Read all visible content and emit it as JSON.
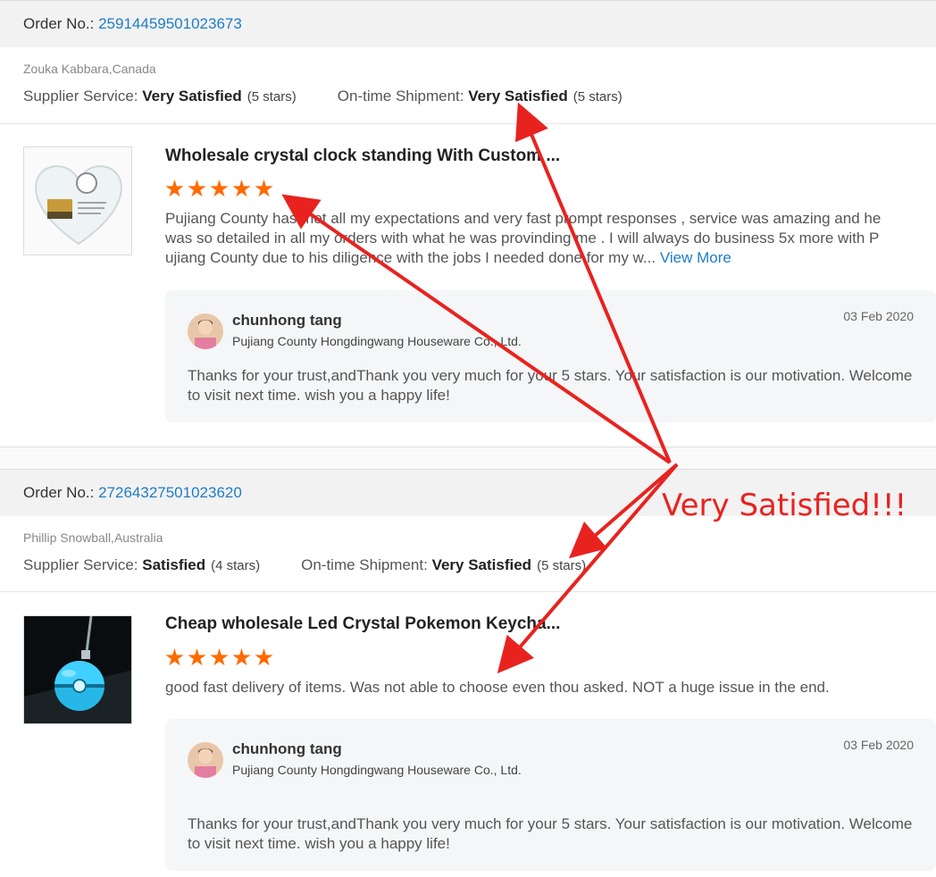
{
  "reviews": [
    {
      "order_label": "Order No.: ",
      "order_number": "25914459501023673",
      "buyer": "Zouka Kabbara,Canada",
      "supplier_label": "Supplier Service: ",
      "supplier_value": "Very Satisfied",
      "supplier_stars": "(5 stars)",
      "shipment_label": "On-time Shipment: ",
      "shipment_value": "Very Satisfied",
      "shipment_stars": "(5 stars)",
      "product_title": "Wholesale crystal clock standing With Custom ...",
      "rating": 5,
      "comment": "Pujiang County has met all my expectations and very fast prompt responses , service was amazing and he was so detailed in all my orders with what he was provinding me . I will always do business 5x more with P ujiang County due to his diligence with the jobs I needed done for my w...",
      "view_more": "View More",
      "reply": {
        "name": "chunhong tang",
        "company": "Pujiang County Hongdingwang Houseware Co., Ltd.",
        "date": "03 Feb 2020",
        "text": "Thanks for your trust,andThank you very much for your 5 stars. Your satisfaction is our motivation. Welcome to visit next time. wish you a happy life!"
      }
    },
    {
      "order_label": "Order No.: ",
      "order_number": "27264327501023620",
      "buyer": "Phillip Snowball,Australia",
      "supplier_label": "Supplier Service: ",
      "supplier_value": "Satisfied",
      "supplier_stars": "(4 stars)",
      "shipment_label": "On-time Shipment: ",
      "shipment_value": "Very Satisfied",
      "shipment_stars": "(5 stars)",
      "product_title": "Cheap wholesale Led Crystal Pokemon Keycha...",
      "rating": 5,
      "comment": "good fast delivery of items.  Was not able to choose even thou asked.  NOT a huge issue in the end.",
      "reply": {
        "name": "chunhong tang",
        "company": "Pujiang County Hongdingwang Houseware Co., Ltd.",
        "date": "03 Feb 2020",
        "text": "Thanks for your trust,andThank you very much for your 5 stars. Your satisfaction is our motivation. Welcome to visit next time. wish you a happy life!"
      }
    }
  ],
  "annotation": "Very Satisfied!!!",
  "colors": {
    "accent": "#ff6a00",
    "link": "#1f7cc7",
    "annotation": "#e8231f"
  }
}
